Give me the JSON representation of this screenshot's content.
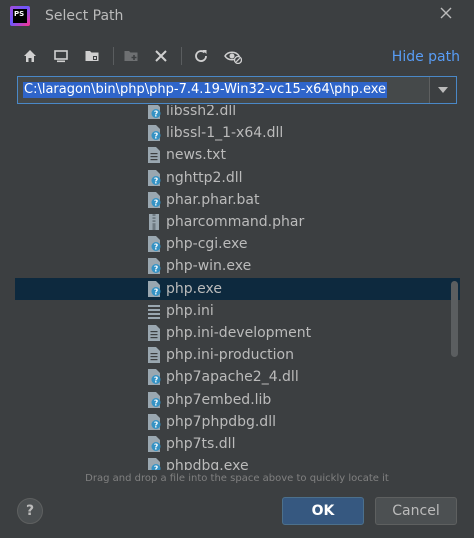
{
  "window": {
    "title": "Select Path",
    "app_icon_text": "PS"
  },
  "toolbar": {
    "buttons": [
      "home-icon",
      "desktop-icon",
      "project-folder-icon",
      "new-folder-icon",
      "delete-icon",
      "refresh-icon",
      "show-hidden-icon"
    ],
    "hide_path_label": "Hide path"
  },
  "path_field": {
    "value": "C:\\laragon\\bin\\php\\php-7.4.19-Win32-vc15-x64\\php.exe"
  },
  "file_list": {
    "items": [
      {
        "name": "libssh2.dll",
        "icon": "unknown-file-icon"
      },
      {
        "name": "libssl-1_1-x64.dll",
        "icon": "unknown-file-icon"
      },
      {
        "name": "news.txt",
        "icon": "text-file-icon"
      },
      {
        "name": "nghttp2.dll",
        "icon": "unknown-file-icon"
      },
      {
        "name": "phar.phar.bat",
        "icon": "unknown-file-icon"
      },
      {
        "name": "pharcommand.phar",
        "icon": "archive-file-icon"
      },
      {
        "name": "php-cgi.exe",
        "icon": "unknown-file-icon"
      },
      {
        "name": "php-win.exe",
        "icon": "unknown-file-icon"
      },
      {
        "name": "php.exe",
        "icon": "unknown-file-icon",
        "selected": true
      },
      {
        "name": "php.ini",
        "icon": "config-file-icon"
      },
      {
        "name": "php.ini-development",
        "icon": "text-file-icon"
      },
      {
        "name": "php.ini-production",
        "icon": "text-file-icon"
      },
      {
        "name": "php7apache2_4.dll",
        "icon": "unknown-file-icon"
      },
      {
        "name": "php7embed.lib",
        "icon": "unknown-file-icon"
      },
      {
        "name": "php7phpdbg.dll",
        "icon": "unknown-file-icon"
      },
      {
        "name": "php7ts.dll",
        "icon": "unknown-file-icon"
      },
      {
        "name": "phpdbg.exe",
        "icon": "unknown-file-icon"
      }
    ]
  },
  "hint": "Drag and drop a file into the space above to quickly locate it",
  "buttons": {
    "help": "?",
    "ok": "OK",
    "cancel": "Cancel"
  },
  "colors": {
    "background": "#3c3f41",
    "selection": "#0d293e",
    "accent_link": "#589df6",
    "path_highlight": "#2f65ca",
    "ok_button": "#365880"
  }
}
